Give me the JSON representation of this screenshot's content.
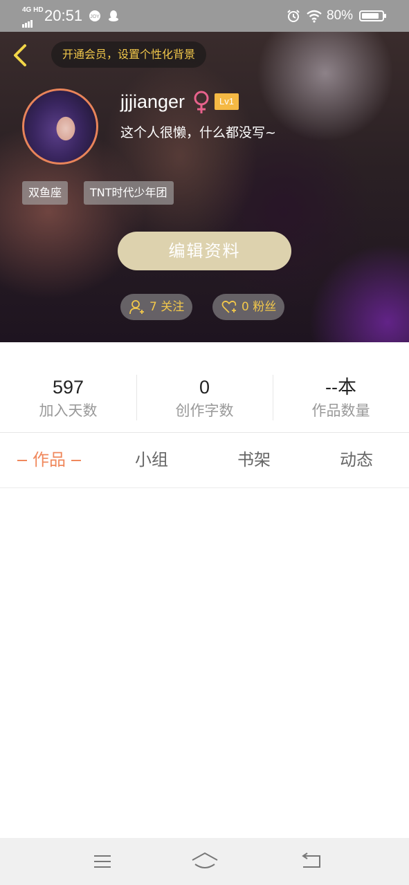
{
  "status_bar": {
    "network": "4G HD",
    "time": "20:51",
    "battery_percent": "80%",
    "icons": [
      "signal-icon",
      "notification-icon",
      "qq-icon",
      "alarm-icon",
      "wifi-icon",
      "battery-icon"
    ]
  },
  "profile": {
    "vip_banner": "开通会员，设置个性化背景",
    "username": "jjjianger",
    "gender_icon": "female-icon",
    "level": "Lv1",
    "bio": "这个人很懒，什么都没写~",
    "tags": [
      "双鱼座",
      "TNT时代少年团"
    ],
    "edit_button": "编辑资料",
    "following": "7 关注",
    "followers": "0 粉丝"
  },
  "stats": [
    {
      "value": "597",
      "label": "加入天数"
    },
    {
      "value": "0",
      "label": "创作字数"
    },
    {
      "value": "--本",
      "label": "作品数量"
    }
  ],
  "tabs": [
    {
      "label": "作品",
      "active": true
    },
    {
      "label": "小组",
      "active": false
    },
    {
      "label": "书架",
      "active": false
    },
    {
      "label": "动态",
      "active": false
    }
  ],
  "colors": {
    "accent": "#f0885c",
    "gold": "#f2c84b",
    "level_badge": "#f5b944",
    "edit_button": "#ddd2ae",
    "female": "#e8628c"
  },
  "nav_bar": {
    "icons": [
      "menu-icon",
      "home-icon",
      "back-icon"
    ]
  }
}
